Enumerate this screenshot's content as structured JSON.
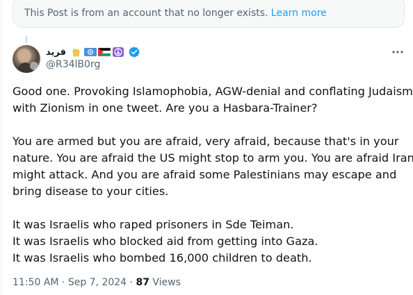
{
  "notice": {
    "text": "This Post is from an account that no longer exists.",
    "link_label": "Learn more"
  },
  "author": {
    "display_name": "فريد",
    "handle": "@R34lB0rg",
    "verified": true,
    "emoji_icons": [
      "vulcan-salute-icon",
      "un-flag-icon",
      "palestine-flag-icon",
      "peace-symbol-icon"
    ]
  },
  "tweet": {
    "paragraphs": [
      [
        "Good one. Provoking Islamophobia, AGW-denial and conflating Judaism",
        "with Zionism in one tweet. Are you a Hasbara-Trainer?"
      ],
      [
        "You are armed but you are afraid, very afraid, because that's in your",
        "nature. You are afraid the US might stop to arm you. You are afraid Iran",
        "might attack. And you are afraid some Palestinians may escape and",
        "bring disease to your cities."
      ],
      [
        "It was Israelis who raped prisoners in Sde Teiman.",
        "It was Israelis who blocked aid from getting into Gaza.",
        "It was Israelis who bombed 16,000 children to death."
      ]
    ]
  },
  "meta": {
    "time": "11:50 AM",
    "separator": "·",
    "date": "Sep 7, 2024",
    "views_count": "87",
    "views_label": "Views"
  },
  "colors": {
    "accent": "#1d9bf0",
    "secondary_text": "#536471",
    "primary_text": "#0f1419"
  }
}
